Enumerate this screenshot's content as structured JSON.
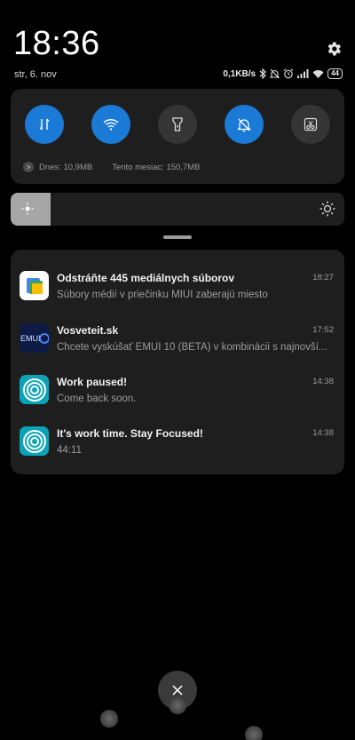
{
  "header": {
    "time": "18:36",
    "date": "str, 6. nov",
    "net_speed": "0,1KB/s",
    "battery": "44"
  },
  "quick_settings": {
    "toggles": [
      {
        "name": "mobile-data",
        "state": "on"
      },
      {
        "name": "wifi",
        "state": "on"
      },
      {
        "name": "flashlight",
        "state": "off"
      },
      {
        "name": "silent",
        "state": "on"
      },
      {
        "name": "screenshot",
        "state": "off"
      }
    ],
    "usage_today": "Dnes: 10,9MB",
    "usage_month": "Tento mesiac: 150,7MB"
  },
  "brightness": {
    "level": 0.12
  },
  "notifications": [
    {
      "title": "Odstráňte 445 mediálnych súborov",
      "time": "18:27",
      "text": "Súbory médií v priečinku MIUI zaberajú miesto",
      "app_icon": "files-icon"
    },
    {
      "title": "Vosveteit.sk",
      "time": "17:52",
      "text": "Chcete vyskúšať EMUI 10 (BETA) v kombinácii s najnovší...",
      "app_icon": "emui-icon"
    },
    {
      "title": "Work paused!",
      "time": "14:38",
      "text": "Come back soon.",
      "app_icon": "focus-timer-icon"
    },
    {
      "title": "It's work time. Stay Focused!",
      "time": "14:38",
      "text": "44:11",
      "app_icon": "focus-timer-icon"
    }
  ],
  "emui_logo_text": "EMUI",
  "colors": {
    "accent": "#1a7ad6",
    "panel": "#1e1e1e",
    "background": "#000000"
  }
}
